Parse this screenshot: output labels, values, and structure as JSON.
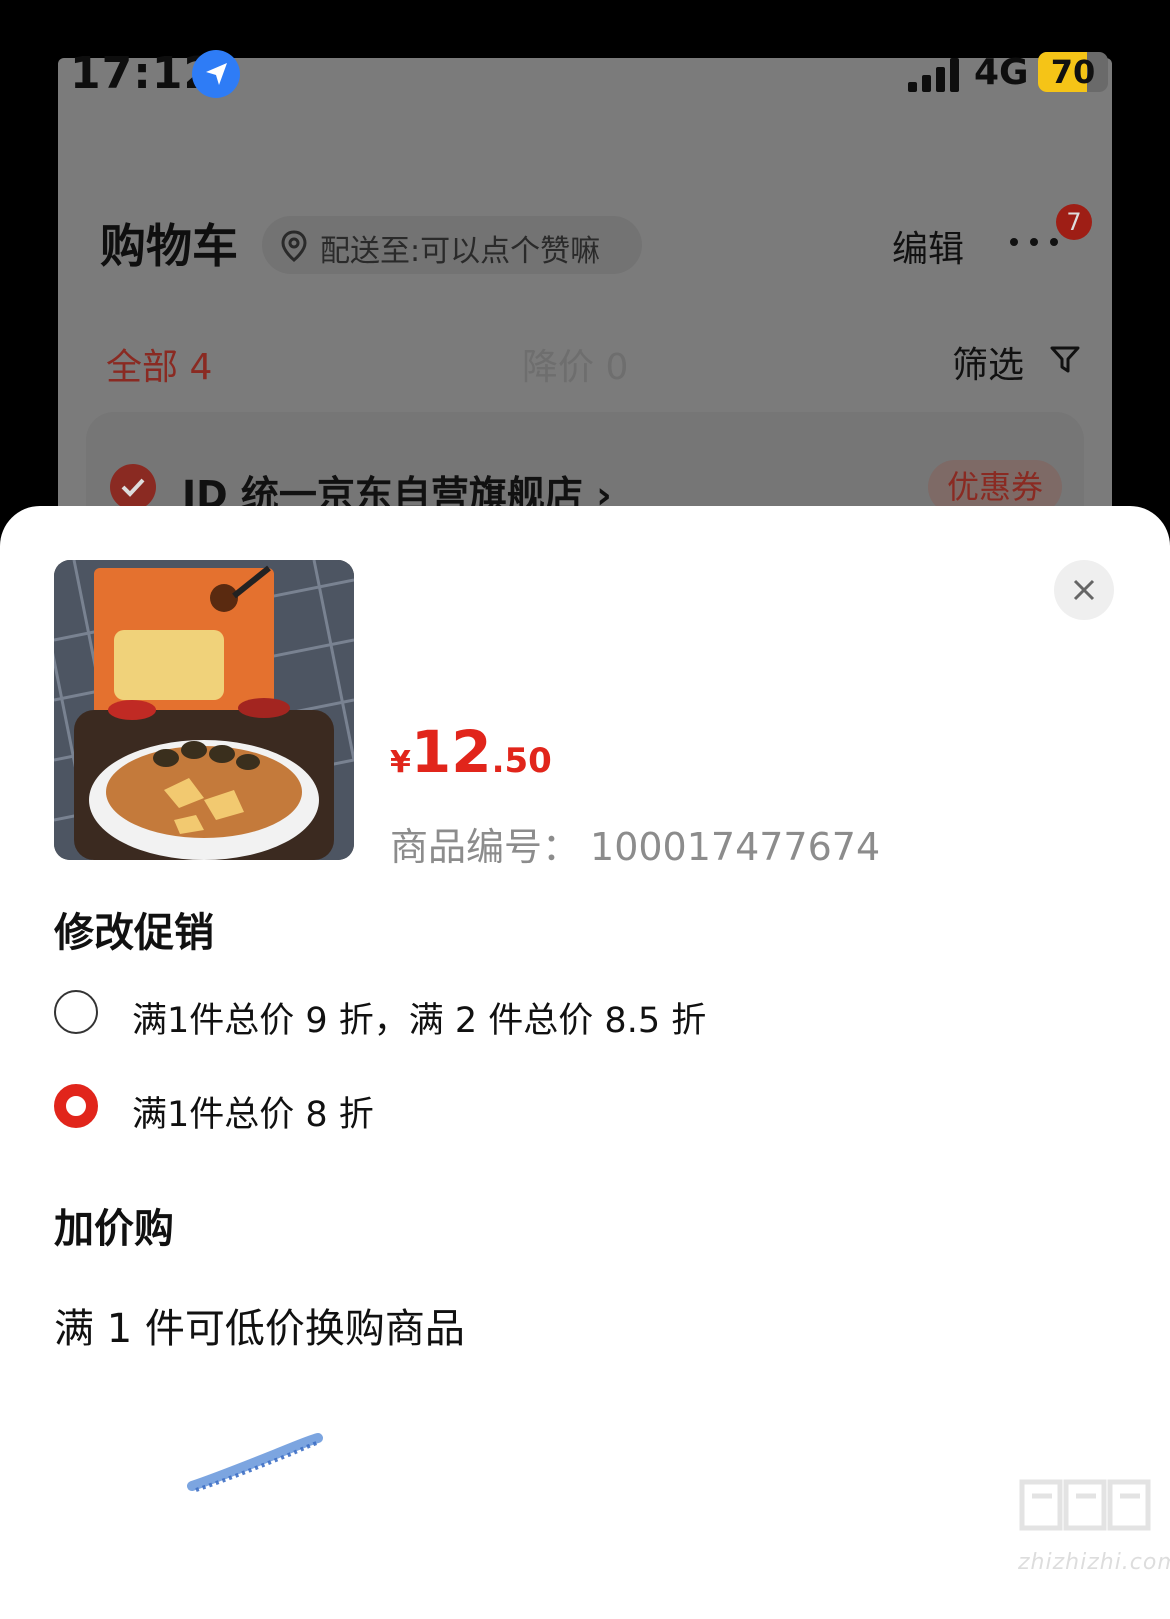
{
  "status_bar": {
    "time": "17:12",
    "network": "4G",
    "battery_label": "70",
    "battery_level_percent": 70,
    "icons": [
      "location-arrow-icon",
      "signal-bars-icon",
      "battery-icon"
    ]
  },
  "header": {
    "title": "购物车",
    "address": "配送至:可以点个赞嘛",
    "edit_label": "编辑",
    "more_badge": "7"
  },
  "tabs": {
    "all": "全部 4",
    "price_drop": "降价 0",
    "filter": "筛选"
  },
  "store": {
    "name": "JD 统一京东自营旗舰店 ›",
    "coupon": "优惠券"
  },
  "sheet": {
    "price": {
      "symbol": "¥",
      "integer": "12",
      "decimal": ".50"
    },
    "sku_label": "商品编号：",
    "sku_value": "100017477674",
    "promo_section_title": "修改促销",
    "promotions": [
      {
        "label": "满1件总价 9 折，满 2 件总价 8.5 折",
        "selected": false
      },
      {
        "label": "满1件总价 8 折",
        "selected": true
      }
    ],
    "addon_section_title": "加价购",
    "addon_description": "满 1 件可低价换购商品"
  },
  "watermark": {
    "text": "zhizhizhi.com"
  },
  "colors": {
    "accent": "#e1251b",
    "overlay_bg": "#7b7b7b",
    "location_blue": "#2e7cf6",
    "battery_yellow": "#f5c417"
  }
}
